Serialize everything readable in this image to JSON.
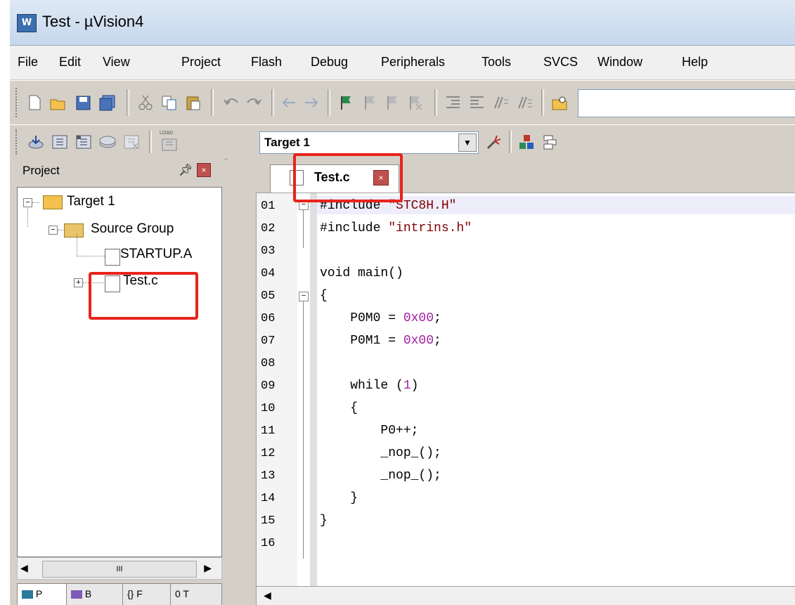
{
  "window": {
    "title": "Test  - µVision4",
    "app_icon_text": "W"
  },
  "menu": {
    "items": [
      "File",
      "Edit",
      "View",
      "Project",
      "Flash",
      "Debug",
      "Peripherals",
      "Tools",
      "SVCS",
      "Window",
      "Help"
    ]
  },
  "toolbar2": {
    "load_label": "LOAD",
    "target_select": "Target 1"
  },
  "project_panel": {
    "title": "Project",
    "tree": {
      "target": "Target 1",
      "group": "Source Group",
      "files": [
        "STARTUP.A",
        "Test.c"
      ]
    },
    "scroll_thumb_text": "III",
    "tabs": [
      "P",
      "B",
      "{} F",
      "0 T"
    ]
  },
  "editor": {
    "tab_label": "Test.c",
    "line_numbers": [
      "01",
      "02",
      "03",
      "04",
      "05",
      "06",
      "07",
      "08",
      "09",
      "10",
      "11",
      "12",
      "13",
      "14",
      "15",
      "16"
    ],
    "code_lines": [
      "#include \"STC8H.H\"",
      "#include \"intrins.h\"",
      "",
      "void main()",
      "{",
      "    P0M0 = 0x00;",
      "    P0M1 = 0x00;",
      "",
      "    while (1)",
      "    {",
      "        P0++;",
      "        _nop_();",
      "        _nop_();",
      "    }",
      "}",
      ""
    ]
  },
  "colors": {
    "annotation": "#e8231b",
    "string": "#800000",
    "number": "#a020a0"
  },
  "icons": {
    "toolbar1": [
      "new-file-icon",
      "open-icon",
      "save-icon",
      "save-all-icon",
      "cut-icon",
      "copy-icon",
      "paste-icon",
      "undo-icon",
      "redo-icon",
      "back-icon",
      "forward-icon",
      "bookmark-icon",
      "prev-bookmark-icon",
      "next-bookmark-icon",
      "clear-bookmarks-icon",
      "indent-icon",
      "unindent-icon",
      "comment-icon",
      "uncomment-icon",
      "find-in-files-icon"
    ],
    "toolbar2": [
      "translate-icon",
      "build-icon",
      "rebuild-icon",
      "batch-build-icon",
      "stop-build-icon",
      "download-icon",
      "target-options-icon",
      "manage-components-icon",
      "manage-books-icon"
    ]
  }
}
